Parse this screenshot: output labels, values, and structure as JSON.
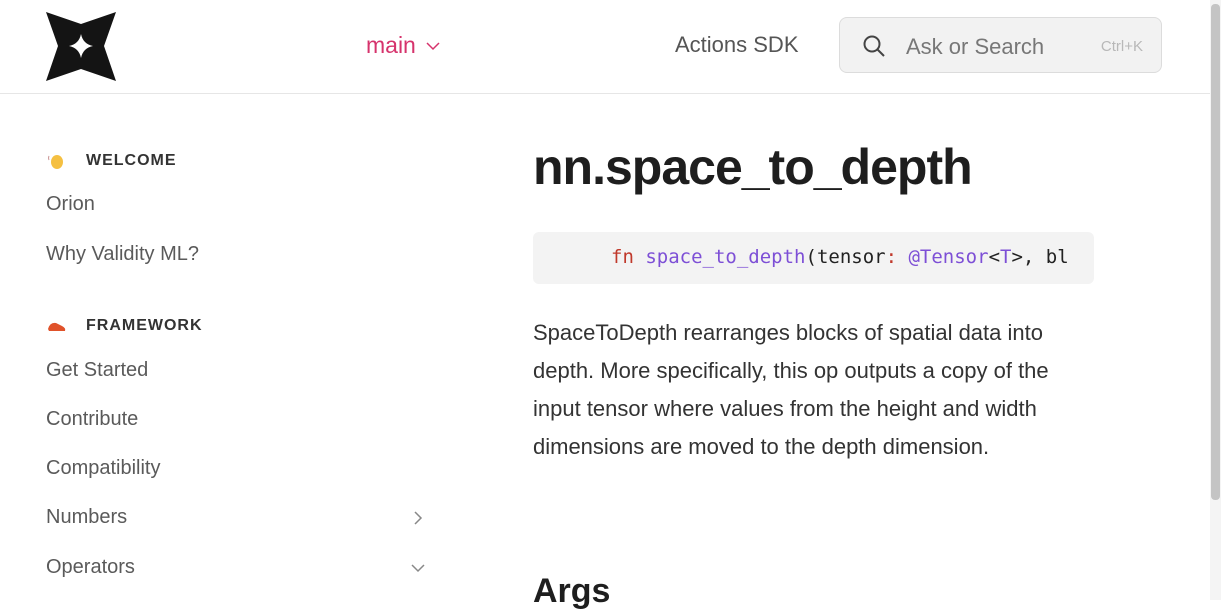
{
  "header": {
    "branch_label": "main",
    "actions_label": "Actions SDK",
    "search": {
      "placeholder": "Ask or Search",
      "shortcut": "Ctrl+K"
    }
  },
  "sidebar": {
    "sections": [
      {
        "title": "WELCOME",
        "icon": "waving-hand-icon",
        "items": [
          "Orion",
          "Why Validity ML?"
        ]
      },
      {
        "title": "FRAMEWORK",
        "icon": "shoe-icon",
        "items": [
          "Get Started",
          "Contribute",
          "Compatibility",
          "Numbers",
          "Operators"
        ]
      }
    ]
  },
  "main": {
    "title": "nn.space_to_depth",
    "code": {
      "keyword": "fn",
      "func": "space_to_depth",
      "open": "(tensor",
      "colon": ":",
      "at_type": "@Tensor",
      "lt": "<",
      "tparam": "T",
      "rest": ">, bl"
    },
    "description": "SpaceToDepth rearranges blocks of spatial data into depth. More specifically, this op outputs a copy of the input tensor where values from the height and width dimensions are moved to the depth dimension.",
    "next_heading": "Args"
  },
  "colors": {
    "accent": "#d6336c",
    "code_keyword": "#c0392b",
    "code_func": "#7d4fd6"
  }
}
